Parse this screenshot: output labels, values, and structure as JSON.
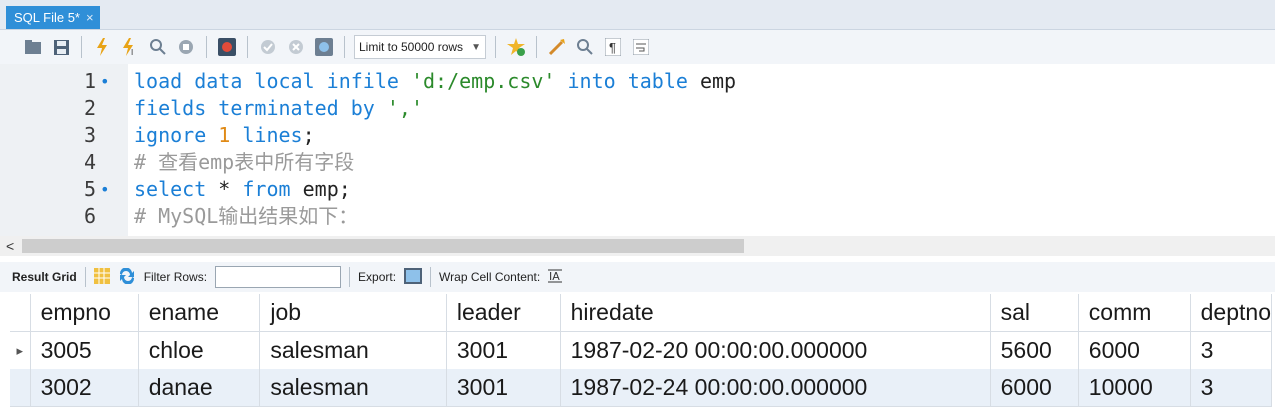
{
  "tab": {
    "title": "SQL File 5*",
    "close": "×"
  },
  "toolbar": {
    "limit_label": "Limit to 50000 rows"
  },
  "editor": {
    "lines": [
      {
        "num": "1",
        "dot": "•",
        "tokens": [
          [
            "kw",
            "load data local infile "
          ],
          [
            "str",
            "'d:/emp.csv'"
          ],
          [
            "kw",
            " into table "
          ],
          [
            "ident",
            "emp"
          ]
        ]
      },
      {
        "num": "2",
        "dot": "",
        "tokens": [
          [
            "kw",
            "fields terminated by "
          ],
          [
            "str",
            "','"
          ]
        ]
      },
      {
        "num": "3",
        "dot": "",
        "tokens": [
          [
            "kw",
            "ignore "
          ],
          [
            "num",
            "1"
          ],
          [
            "kw",
            " lines"
          ],
          [
            "ident",
            ";"
          ]
        ]
      },
      {
        "num": "4",
        "dot": "",
        "tokens": [
          [
            "comment",
            "# 查看emp表中所有字段"
          ]
        ]
      },
      {
        "num": "5",
        "dot": "•",
        "tokens": [
          [
            "kw",
            "select "
          ],
          [
            "ident",
            "* "
          ],
          [
            "kw",
            "from "
          ],
          [
            "ident",
            "emp;"
          ]
        ]
      },
      {
        "num": "6",
        "dot": "",
        "tokens": [
          [
            "comment",
            "# MySQL输出结果如下："
          ]
        ]
      }
    ]
  },
  "hscroll": {
    "left_arrow": "<"
  },
  "result_toolbar": {
    "result_grid": "Result Grid",
    "filter_rows": "Filter Rows:",
    "export": "Export:",
    "wrap": "Wrap Cell Content:"
  },
  "grid": {
    "columns": [
      "empno",
      "ename",
      "job",
      "leader",
      "hiredate",
      "sal",
      "comm",
      "deptno"
    ],
    "rows": [
      [
        "3005",
        "chloe",
        "salesman",
        "3001",
        "1987-02-20 00:00:00.000000",
        "5600",
        "6000",
        "3"
      ],
      [
        "3002",
        "danae",
        "salesman",
        "3001",
        "1987-02-24 00:00:00.000000",
        "6000",
        "10000",
        "3"
      ]
    ],
    "row_marker": "▸"
  }
}
